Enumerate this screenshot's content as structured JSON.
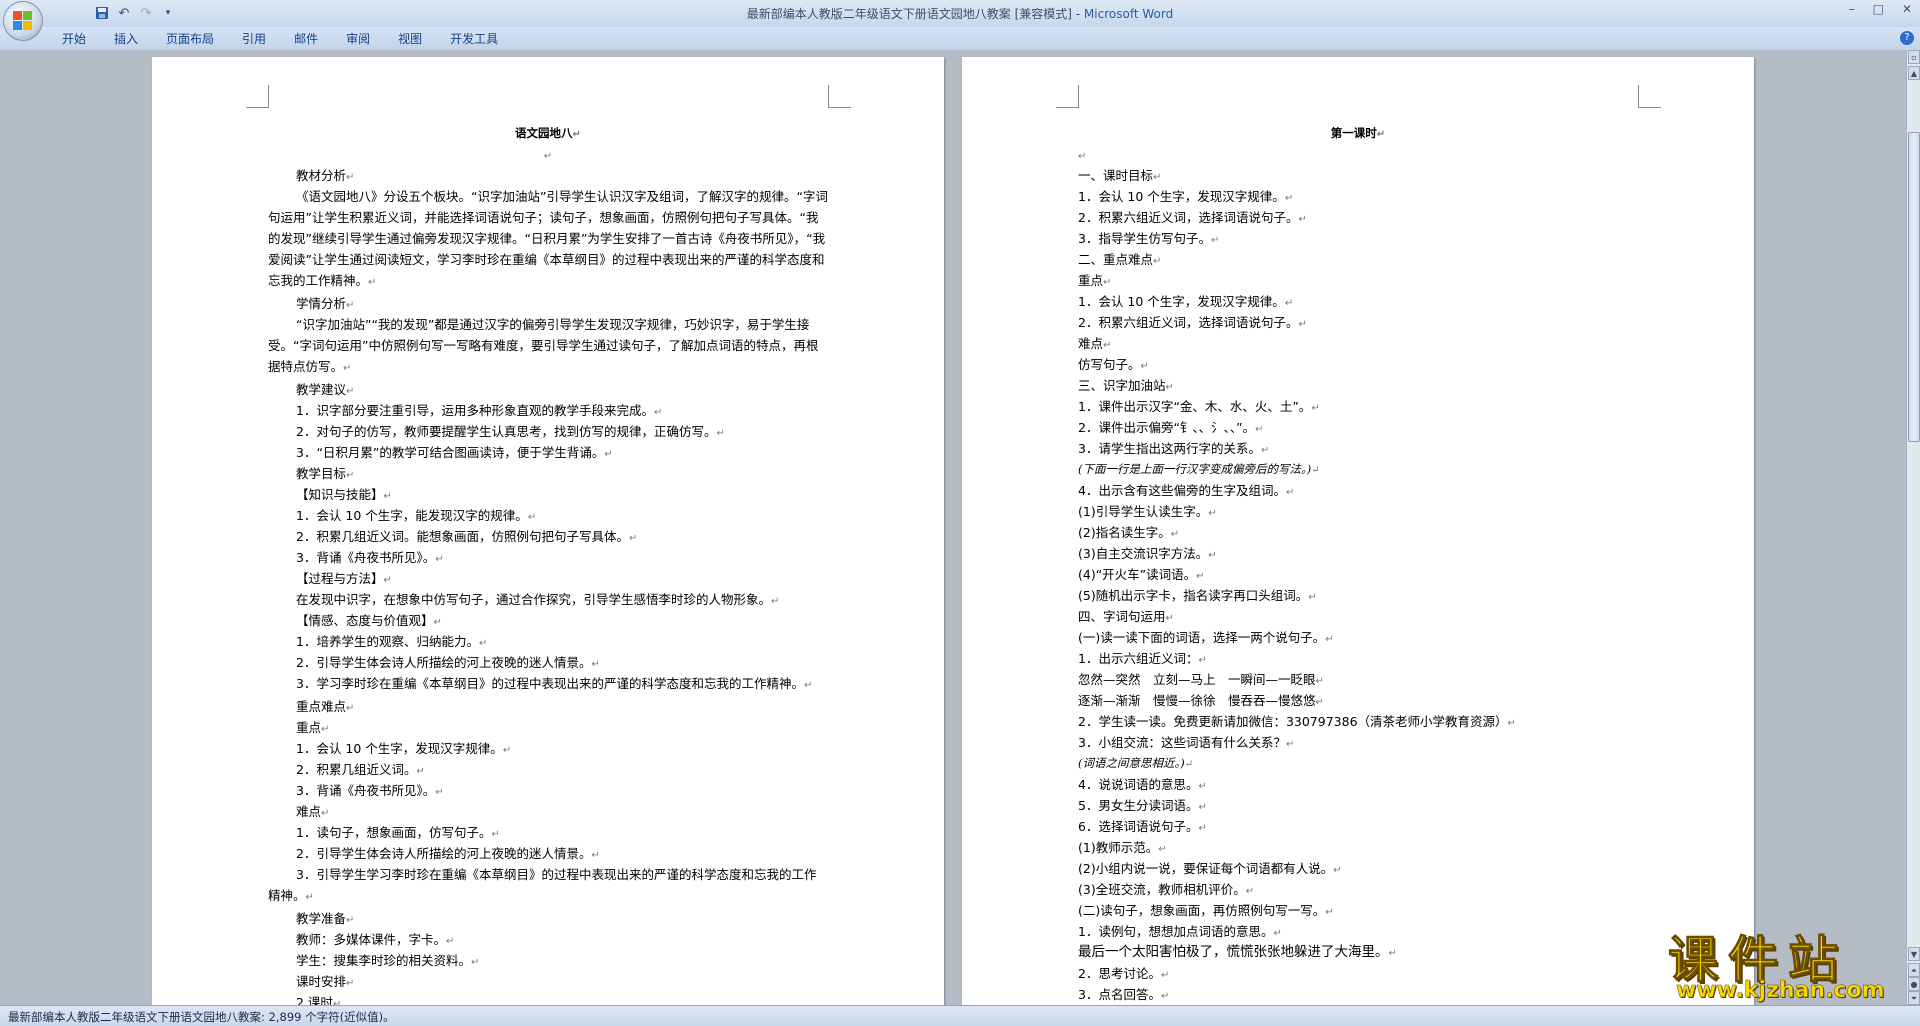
{
  "window": {
    "title": "最新部编本人教版二年级语文下册语文园地八教案 [兼容模式] - ",
    "app_name": "Microsoft Word",
    "controls": [
      "–",
      "□",
      "✕"
    ]
  },
  "quick_access": {
    "icons": [
      "save-icon",
      "undo-icon",
      "redo-icon",
      "customize-dropdown-icon"
    ]
  },
  "ribbon": {
    "tabs": [
      "开始",
      "插入",
      "页面布局",
      "引用",
      "邮件",
      "审阅",
      "视图",
      "开发工具"
    ],
    "help": "?"
  },
  "pilcrow": "↵",
  "left_page": {
    "title": "语文园地八",
    "lines": [
      {
        "text": "教材分析",
        "style": "ind"
      },
      {
        "text": "《语文园地八》分设五个板块。“识字加油站”引导学生认识汉字及组词，了解汉字的规律。“字词句运用”让学生积累近义词，并能选择词语说句子；读句子，想象画面，仿照例句把句子写具体。“我的发现”继续引导学生通过偏旁发现汉字规律。“日积月累”为学生安排了一首古诗《舟夜书所见》，“我爱阅读”让学生通过阅读短文，学习李时珍在重编《本草纲目》的过程中表现出来的严谨的科学态度和忘我的工作精神。",
        "style": "para"
      },
      {
        "text": "学情分析",
        "style": "ind"
      },
      {
        "text": "“识字加油站”“我的发现”都是通过汉字的偏旁引导学生发现汉字规律，巧妙识字，易于学生接受。“字词句运用”中仿照例句写一写略有难度，要引导学生通过读句子，了解加点词语的特点，再根据特点仿写。",
        "style": "para"
      },
      {
        "text": "教学建议",
        "style": "ind"
      },
      {
        "text": "1．识字部分要注重引导，运用多种形象直观的教学手段来完成。",
        "style": "ind"
      },
      {
        "text": "2．对句子的仿写，教师要提醒学生认真思考，找到仿写的规律，正确仿写。",
        "style": "ind"
      },
      {
        "text": "3．“日积月累”的教学可结合图画读诗，便于学生背诵。",
        "style": "ind"
      },
      {
        "text": "教学目标",
        "style": "ind"
      },
      {
        "text": "【知识与技能】",
        "style": "ind"
      },
      {
        "text": "1．会认 10 个生字，能发现汉字的规律。",
        "style": "ind"
      },
      {
        "text": "2．积累几组近义词。能想象画面，仿照例句把句子写具体。",
        "style": "ind"
      },
      {
        "text": "3．背诵《舟夜书所见》。",
        "style": "ind"
      },
      {
        "text": "【过程与方法】",
        "style": "ind"
      },
      {
        "text": "在发现中识字，在想象中仿写句子，通过合作探究，引导学生感悟李时珍的人物形象。",
        "style": "ind"
      },
      {
        "text": "【情感、态度与价值观】",
        "style": "ind"
      },
      {
        "text": "1．培养学生的观察、归纳能力。",
        "style": "ind"
      },
      {
        "text": "2．引导学生体会诗人所描绘的河上夜晚的迷人情景。",
        "style": "ind"
      },
      {
        "text": "3．学习李时珍在重编《本草纲目》的过程中表现出来的严谨的科学态度和忘我的工作精神。",
        "style": "para"
      },
      {
        "text": "重点难点",
        "style": "ind"
      },
      {
        "text": "重点",
        "style": "ind"
      },
      {
        "text": "1．会认 10 个生字，发现汉字规律。",
        "style": "ind"
      },
      {
        "text": "2．积累几组近义词。",
        "style": "ind"
      },
      {
        "text": "3．背诵《舟夜书所见》。",
        "style": "ind"
      },
      {
        "text": "难点",
        "style": "ind"
      },
      {
        "text": "1．读句子，想象画面，仿写句子。",
        "style": "ind"
      },
      {
        "text": "2．引导学生体会诗人所描绘的河上夜晚的迷人情景。",
        "style": "ind"
      },
      {
        "text": "3．引导学生学习李时珍在重编《本草纲目》的过程中表现出来的严谨的科学态度和忘我的工作精神。",
        "style": "para"
      },
      {
        "text": "教学准备",
        "style": "ind"
      },
      {
        "text": "教师：多媒体课件，字卡。",
        "style": "ind"
      },
      {
        "text": "学生：搜集李时珍的相关资料。",
        "style": "ind"
      },
      {
        "text": "课时安排",
        "style": "ind"
      },
      {
        "text": "2 课时",
        "style": "ind"
      }
    ]
  },
  "right_page": {
    "title": "第一课时",
    "lines": [
      {
        "text": "",
        "style": ""
      },
      {
        "text": "一、课时目标",
        "style": ""
      },
      {
        "text": "1．会认 10 个生字，发现汉字规律。",
        "style": ""
      },
      {
        "text": "2．积累六组近义词，选择词语说句子。",
        "style": ""
      },
      {
        "text": "3．指导学生仿写句子。",
        "style": ""
      },
      {
        "text": "二、重点难点",
        "style": ""
      },
      {
        "text": "重点",
        "style": ""
      },
      {
        "text": "1．会认 10 个生字，发现汉字规律。",
        "style": ""
      },
      {
        "text": "2．积累六组近义词，选择词语说句子。",
        "style": ""
      },
      {
        "text": "难点",
        "style": ""
      },
      {
        "text": "仿写句子。",
        "style": ""
      },
      {
        "text": "三、识字加油站",
        "style": ""
      },
      {
        "text": "1．课件出示汉字“金、木、水、火、土”。",
        "style": ""
      },
      {
        "text": "2．课件出示偏旁“钅、、氵、、”。",
        "style": ""
      },
      {
        "text": "3．请学生指出这两行字的关系。",
        "style": ""
      },
      {
        "text": "(下面一行是上面一行汉字变成偏旁后的写法。)",
        "style": "hand"
      },
      {
        "text": "4．出示含有这些偏旁的生字及组词。",
        "style": ""
      },
      {
        "text": "(1)引导学生认读生字。",
        "style": ""
      },
      {
        "text": "(2)指名读生字。",
        "style": ""
      },
      {
        "text": "(3)自主交流识字方法。",
        "style": ""
      },
      {
        "text": "(4)“开火车”读词语。",
        "style": ""
      },
      {
        "text": "(5)随机出示字卡，指名读字再口头组词。",
        "style": ""
      },
      {
        "text": "四、字词句运用",
        "style": ""
      },
      {
        "text": "(一)读一读下面的词语，选择一两个说句子。",
        "style": ""
      },
      {
        "text": "1．出示六组近义词：",
        "style": ""
      },
      {
        "text": "忽然—突然　立刻—马上　一瞬间—一眨眼",
        "style": ""
      },
      {
        "text": "逐渐—渐渐　慢慢—徐徐　慢吞吞—慢悠悠",
        "style": ""
      },
      {
        "text": "2．学生读一读。免费更新请加微信：330797386（清茶老师小学教育资源）",
        "style": ""
      },
      {
        "text": "3．小组交流：这些词语有什么关系？",
        "style": ""
      },
      {
        "text": "(词语之间意思相近。)",
        "style": "hand"
      },
      {
        "text": "4．说说词语的意思。",
        "style": ""
      },
      {
        "text": "5．男女生分读词语。",
        "style": ""
      },
      {
        "text": "6．选择词语说句子。",
        "style": ""
      },
      {
        "text": "(1)教师示范。",
        "style": ""
      },
      {
        "text": "(2)小组内说一说，要保证每个词语都有人说。",
        "style": ""
      },
      {
        "text": "(3)全班交流，教师相机评价。",
        "style": ""
      },
      {
        "text": "(二)读句子，想象画面，再仿照例句写一写。",
        "style": ""
      },
      {
        "text": "1．读例句，想想加点词语的意思。",
        "style": ""
      },
      {
        "text": "最后一个太阳害怕极了，慌慌张张地躲进了大海里。",
        "style": "big"
      },
      {
        "text": "2．思考讨论。",
        "style": ""
      },
      {
        "text": "3．点名回答。",
        "style": ""
      }
    ]
  },
  "status": {
    "text": "最新部编本人教版二年级语文下册语文园地八教案: 2,899 个字符(近似值)。"
  },
  "watermark": {
    "brand": "课件站",
    "url": "www.kjzhan.com"
  },
  "colors": {
    "ribbon_text": "#15428b",
    "watermark": "#f5d800"
  }
}
